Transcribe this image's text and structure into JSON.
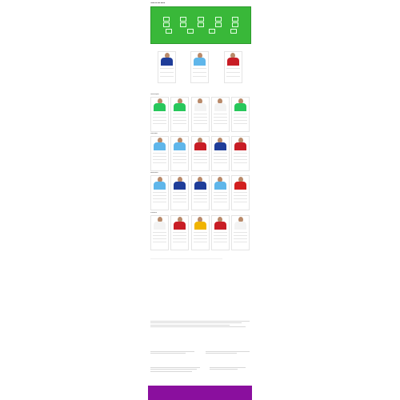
{
  "page": {
    "pitch_title": "Team of the week",
    "pitch_caption": "",
    "top_section_title": "",
    "section_title": "",
    "groups": [
      {
        "title": "Goalkeepers"
      },
      {
        "title": "Defenders"
      },
      {
        "title": "Midfielders"
      },
      {
        "title": "Forwards"
      }
    ],
    "table_title": "",
    "text_title": "",
    "subtext_a": "",
    "subtext_b": "",
    "subtext_c": "",
    "subtext_d": ""
  },
  "colors": {
    "pitch": "#39b839",
    "footer": "#8a0f9e",
    "kits": {
      "chelsea": "#1f3d99",
      "city": "#5fb6ea",
      "liverpool": "#c81d25",
      "arsenal": "#d21f1f",
      "wolves": "#f0b400",
      "keeper_green": "#28c75b",
      "white": "#f3f3f3"
    }
  },
  "top_players": [
    {
      "kit": "chelsea"
    },
    {
      "kit": "city"
    },
    {
      "kit": "liverpool"
    }
  ],
  "rows": [
    [
      "keeper_green",
      "keeper_green",
      "white",
      "white",
      "keeper_green"
    ],
    [
      "city",
      "city",
      "liverpool",
      "chelsea",
      "liverpool"
    ],
    [
      "city",
      "chelsea",
      "chelsea",
      "city",
      "arsenal"
    ],
    [
      "white",
      "liverpool",
      "wolves",
      "liverpool",
      "white"
    ]
  ],
  "table": {
    "headers": [
      "",
      "",
      "",
      ""
    ],
    "rows": []
  },
  "footer": {
    "copyright": "",
    "link": ""
  }
}
